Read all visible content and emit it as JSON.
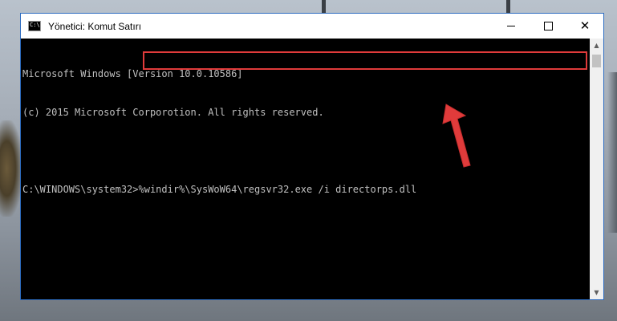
{
  "window": {
    "title": "Yönetici: Komut Satırı",
    "icon_text": "C:\\."
  },
  "console": {
    "lines": [
      "Microsoft Windows [Version 10.0.10586]",
      "(c) 2015 Microsoft Corporotion. All rights reserved.",
      ""
    ],
    "prompt": "C:\\WINDOWS\\system32>",
    "command": "%windir%\\SysWoW64\\regsvr32.exe /i directorps.dll"
  },
  "colors": {
    "highlight": "#e03b3b",
    "arrow": "#e03b3b",
    "console_text": "#c0c0c0"
  },
  "icons": {
    "minimize": "minimize-icon",
    "maximize": "maximize-icon",
    "close": "close-icon"
  }
}
